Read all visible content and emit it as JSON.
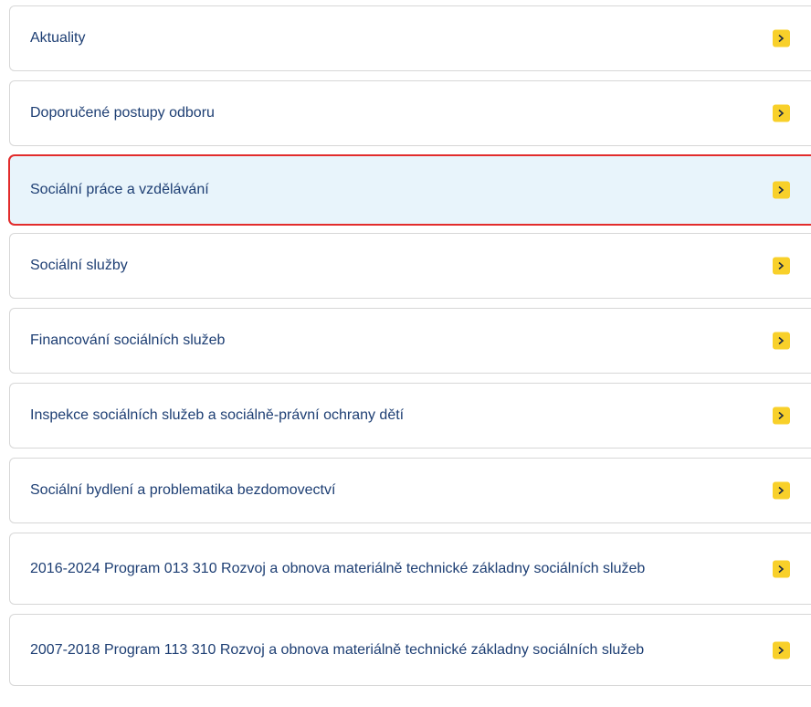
{
  "menu": {
    "items": [
      {
        "label": "Aktuality"
      },
      {
        "label": "Doporučené postupy odboru"
      },
      {
        "label": "Sociální práce a vzdělávání",
        "active": true
      },
      {
        "label": "Sociální služby"
      },
      {
        "label": "Financování sociálních služeb"
      },
      {
        "label": "Inspekce sociálních služeb a sociálně-právní ochrany dětí"
      },
      {
        "label": "Sociální bydlení a problematika bezdomovectví"
      },
      {
        "label": "2016-2024 Program 013 310 Rozvoj a obnova materiálně technické základny sociálních služeb"
      },
      {
        "label": "2007-2018 Program 113 310 Rozvoj a obnova materiálně technické základny sociálních služeb"
      }
    ],
    "arrow_icon": "chevron-right-icon",
    "colors": {
      "label_text": "#1d3e73",
      "arrow_background": "#f8d02a",
      "active_background": "#e8f4fb",
      "active_border": "#e22c2c",
      "item_border": "#d7d7d7"
    }
  }
}
